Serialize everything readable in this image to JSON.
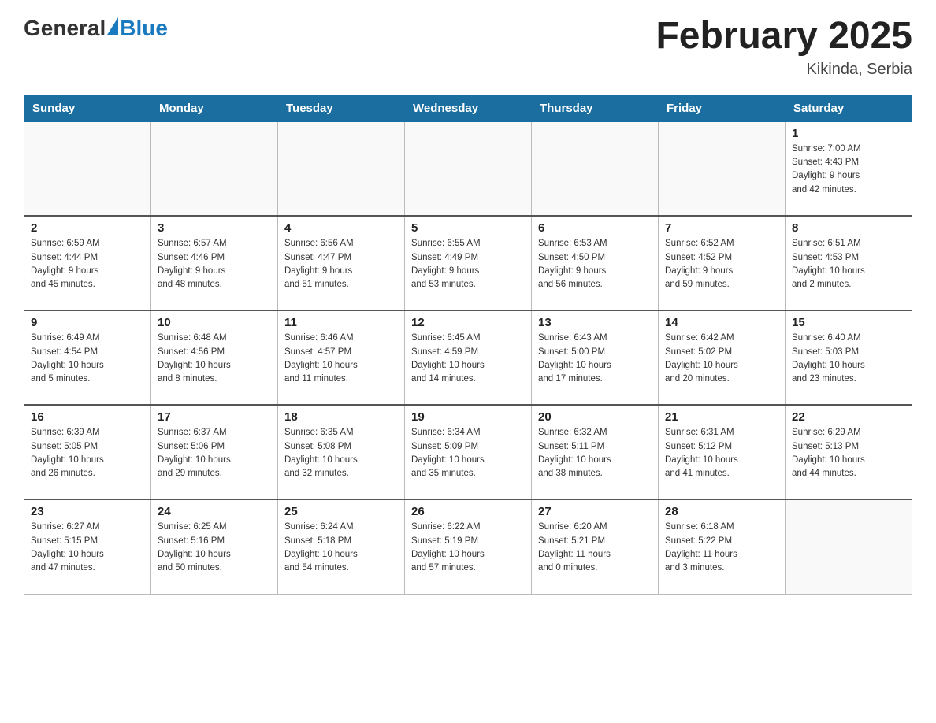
{
  "header": {
    "logo_general": "General",
    "logo_blue": "Blue",
    "title": "February 2025",
    "location": "Kikinda, Serbia"
  },
  "days_of_week": [
    "Sunday",
    "Monday",
    "Tuesday",
    "Wednesday",
    "Thursday",
    "Friday",
    "Saturday"
  ],
  "weeks": [
    [
      {
        "day": "",
        "info": ""
      },
      {
        "day": "",
        "info": ""
      },
      {
        "day": "",
        "info": ""
      },
      {
        "day": "",
        "info": ""
      },
      {
        "day": "",
        "info": ""
      },
      {
        "day": "",
        "info": ""
      },
      {
        "day": "1",
        "info": "Sunrise: 7:00 AM\nSunset: 4:43 PM\nDaylight: 9 hours\nand 42 minutes."
      }
    ],
    [
      {
        "day": "2",
        "info": "Sunrise: 6:59 AM\nSunset: 4:44 PM\nDaylight: 9 hours\nand 45 minutes."
      },
      {
        "day": "3",
        "info": "Sunrise: 6:57 AM\nSunset: 4:46 PM\nDaylight: 9 hours\nand 48 minutes."
      },
      {
        "day": "4",
        "info": "Sunrise: 6:56 AM\nSunset: 4:47 PM\nDaylight: 9 hours\nand 51 minutes."
      },
      {
        "day": "5",
        "info": "Sunrise: 6:55 AM\nSunset: 4:49 PM\nDaylight: 9 hours\nand 53 minutes."
      },
      {
        "day": "6",
        "info": "Sunrise: 6:53 AM\nSunset: 4:50 PM\nDaylight: 9 hours\nand 56 minutes."
      },
      {
        "day": "7",
        "info": "Sunrise: 6:52 AM\nSunset: 4:52 PM\nDaylight: 9 hours\nand 59 minutes."
      },
      {
        "day": "8",
        "info": "Sunrise: 6:51 AM\nSunset: 4:53 PM\nDaylight: 10 hours\nand 2 minutes."
      }
    ],
    [
      {
        "day": "9",
        "info": "Sunrise: 6:49 AM\nSunset: 4:54 PM\nDaylight: 10 hours\nand 5 minutes."
      },
      {
        "day": "10",
        "info": "Sunrise: 6:48 AM\nSunset: 4:56 PM\nDaylight: 10 hours\nand 8 minutes."
      },
      {
        "day": "11",
        "info": "Sunrise: 6:46 AM\nSunset: 4:57 PM\nDaylight: 10 hours\nand 11 minutes."
      },
      {
        "day": "12",
        "info": "Sunrise: 6:45 AM\nSunset: 4:59 PM\nDaylight: 10 hours\nand 14 minutes."
      },
      {
        "day": "13",
        "info": "Sunrise: 6:43 AM\nSunset: 5:00 PM\nDaylight: 10 hours\nand 17 minutes."
      },
      {
        "day": "14",
        "info": "Sunrise: 6:42 AM\nSunset: 5:02 PM\nDaylight: 10 hours\nand 20 minutes."
      },
      {
        "day": "15",
        "info": "Sunrise: 6:40 AM\nSunset: 5:03 PM\nDaylight: 10 hours\nand 23 minutes."
      }
    ],
    [
      {
        "day": "16",
        "info": "Sunrise: 6:39 AM\nSunset: 5:05 PM\nDaylight: 10 hours\nand 26 minutes."
      },
      {
        "day": "17",
        "info": "Sunrise: 6:37 AM\nSunset: 5:06 PM\nDaylight: 10 hours\nand 29 minutes."
      },
      {
        "day": "18",
        "info": "Sunrise: 6:35 AM\nSunset: 5:08 PM\nDaylight: 10 hours\nand 32 minutes."
      },
      {
        "day": "19",
        "info": "Sunrise: 6:34 AM\nSunset: 5:09 PM\nDaylight: 10 hours\nand 35 minutes."
      },
      {
        "day": "20",
        "info": "Sunrise: 6:32 AM\nSunset: 5:11 PM\nDaylight: 10 hours\nand 38 minutes."
      },
      {
        "day": "21",
        "info": "Sunrise: 6:31 AM\nSunset: 5:12 PM\nDaylight: 10 hours\nand 41 minutes."
      },
      {
        "day": "22",
        "info": "Sunrise: 6:29 AM\nSunset: 5:13 PM\nDaylight: 10 hours\nand 44 minutes."
      }
    ],
    [
      {
        "day": "23",
        "info": "Sunrise: 6:27 AM\nSunset: 5:15 PM\nDaylight: 10 hours\nand 47 minutes."
      },
      {
        "day": "24",
        "info": "Sunrise: 6:25 AM\nSunset: 5:16 PM\nDaylight: 10 hours\nand 50 minutes."
      },
      {
        "day": "25",
        "info": "Sunrise: 6:24 AM\nSunset: 5:18 PM\nDaylight: 10 hours\nand 54 minutes."
      },
      {
        "day": "26",
        "info": "Sunrise: 6:22 AM\nSunset: 5:19 PM\nDaylight: 10 hours\nand 57 minutes."
      },
      {
        "day": "27",
        "info": "Sunrise: 6:20 AM\nSunset: 5:21 PM\nDaylight: 11 hours\nand 0 minutes."
      },
      {
        "day": "28",
        "info": "Sunrise: 6:18 AM\nSunset: 5:22 PM\nDaylight: 11 hours\nand 3 minutes."
      },
      {
        "day": "",
        "info": ""
      }
    ]
  ]
}
